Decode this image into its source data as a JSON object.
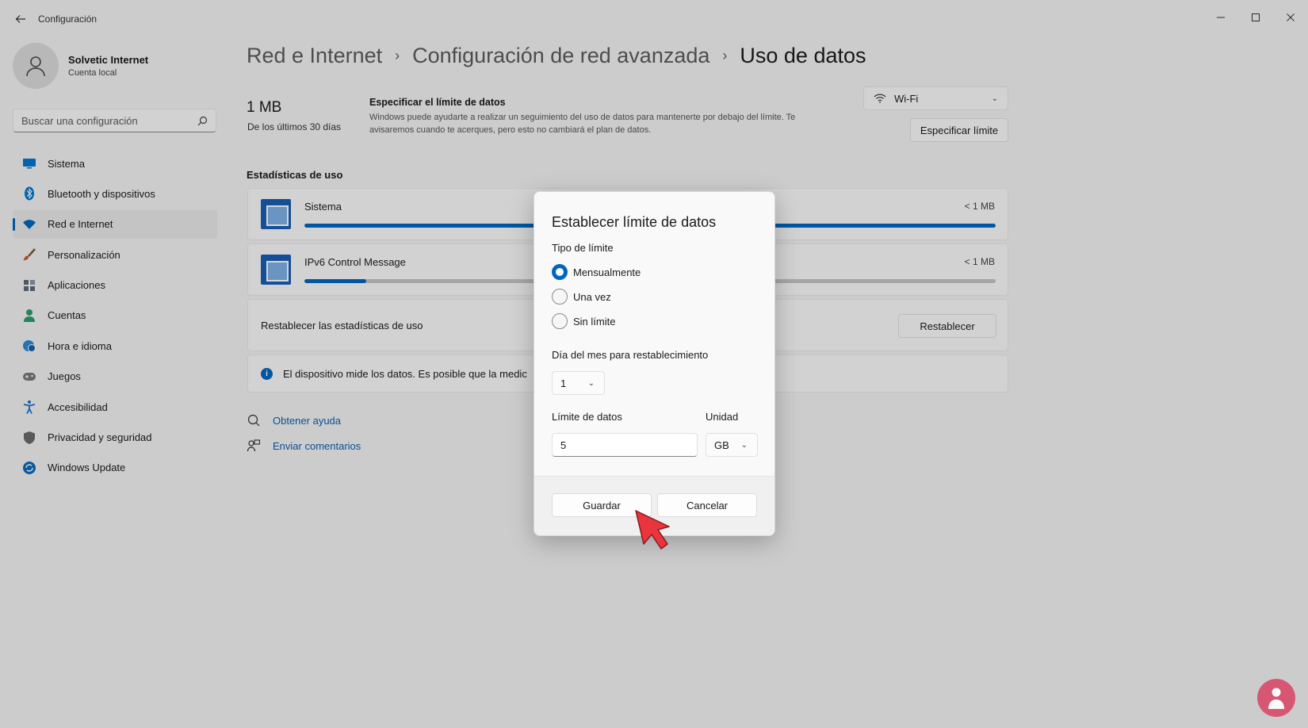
{
  "window": {
    "title": "Configuración",
    "back_icon": "arrow-left-icon"
  },
  "profile": {
    "name": "Solvetic Internet",
    "account_type": "Cuenta local"
  },
  "search": {
    "placeholder": "Buscar una configuración"
  },
  "sidebar": {
    "items": [
      {
        "label": "Sistema",
        "icon": "monitor-icon",
        "color": "#0078d4"
      },
      {
        "label": "Bluetooth y dispositivos",
        "icon": "bluetooth-icon",
        "color": "#0078d4"
      },
      {
        "label": "Red e Internet",
        "icon": "wifi-icon",
        "color": "#0067c0",
        "active": true
      },
      {
        "label": "Personalización",
        "icon": "brush-icon",
        "color": "#d1553b"
      },
      {
        "label": "Aplicaciones",
        "icon": "apps-icon",
        "color": "#5f6b7a"
      },
      {
        "label": "Cuentas",
        "icon": "person-icon",
        "color": "#2e9c6a"
      },
      {
        "label": "Hora e idioma",
        "icon": "globe-clock-icon",
        "color": "#2b8ad8"
      },
      {
        "label": "Juegos",
        "icon": "gamepad-icon",
        "color": "#7a7a7a"
      },
      {
        "label": "Accesibilidad",
        "icon": "accessibility-icon",
        "color": "#1c70c8"
      },
      {
        "label": "Privacidad y seguridad",
        "icon": "shield-icon",
        "color": "#6b6b6b"
      },
      {
        "label": "Windows Update",
        "icon": "update-icon",
        "color": "#0f6cbd"
      }
    ]
  },
  "breadcrumb": {
    "items": [
      "Red e Internet",
      "Configuración de red avanzada"
    ],
    "current": "Uso de datos"
  },
  "usage": {
    "total": "1 MB",
    "period": "De los últimos 30 días"
  },
  "limit_info": {
    "title": "Especificar el límite de datos",
    "description": "Windows puede ayudarte a realizar un seguimiento del uso de datos para mantenerte por debajo del límite. Te avisaremos cuando te acerques, pero esto no cambiará el plan de datos."
  },
  "network_select": {
    "value": "Wi-Fi"
  },
  "specify_limit_button": "Especificar límite",
  "stats": {
    "title": "Estadísticas de uso",
    "apps": [
      {
        "name": "Sistema",
        "size": "< 1 MB",
        "fraction": 1.0
      },
      {
        "name": "IPv6 Control Message",
        "size": "< 1 MB",
        "fraction": 0.09
      }
    ],
    "reset_label": "Restablecer las estadísticas de uso",
    "reset_button": "Restablecer",
    "info_text": "El dispositivo mide los datos. Es posible que la medic"
  },
  "help": {
    "get_help": "Obtener ayuda",
    "feedback": "Enviar comentarios"
  },
  "dialog": {
    "title": "Establecer límite de datos",
    "limit_type_label": "Tipo de límite",
    "options": [
      {
        "label": "Mensualmente",
        "checked": true
      },
      {
        "label": "Una vez",
        "checked": false
      },
      {
        "label": "Sin límite",
        "checked": false
      }
    ],
    "reset_day_label": "Día del mes para restablecimiento",
    "reset_day_value": "1",
    "data_limit_label": "Límite de datos",
    "data_limit_value": "5",
    "unit_label": "Unidad",
    "unit_value": "GB",
    "save_button": "Guardar",
    "cancel_button": "Cancelar"
  },
  "colors": {
    "accent": "#0067c0",
    "background": "#f3f3f3",
    "cursor": "#e8353e"
  }
}
